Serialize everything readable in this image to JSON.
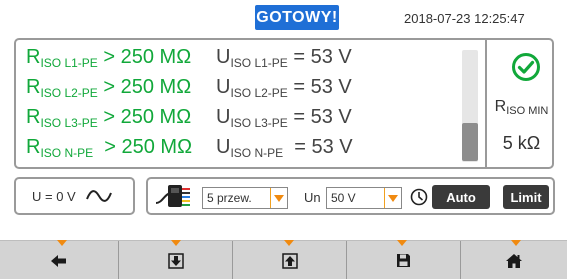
{
  "header": {
    "status": "GOTOWY!",
    "datetime": "2018-07-23 12:25:47"
  },
  "results": [
    {
      "r_main": "R",
      "r_sub": "ISO L1-PE",
      "r_value": " > 250 MΩ",
      "u_main": "U",
      "u_sub": "ISO L1-PE",
      "u_value": " = 53 V"
    },
    {
      "r_main": "R",
      "r_sub": "ISO L2-PE",
      "r_value": " > 250 MΩ",
      "u_main": "U",
      "u_sub": "ISO L2-PE",
      "u_value": " = 53 V"
    },
    {
      "r_main": "R",
      "r_sub": "ISO L3-PE",
      "r_value": " > 250 MΩ",
      "u_main": "U",
      "u_sub": "ISO L3-PE",
      "u_value": " = 53 V"
    },
    {
      "r_main": "R",
      "r_sub": "ISO N-PE",
      "r_value": "  > 250 MΩ",
      "u_main": "U",
      "u_sub": "ISO N-PE",
      "u_value": "  = 53 V"
    }
  ],
  "riso_min": {
    "main": "R",
    "sub": "ISO MIN",
    "value": "5 kΩ"
  },
  "voltage": {
    "text": "U = 0 V"
  },
  "settings": {
    "wires_value": "5 przew.",
    "un_label": "Un",
    "un_value": "50 V",
    "auto_label": "Auto",
    "limit_label": "Limit"
  },
  "scroll_position": 0.66,
  "colors": {
    "status_bg": "#1f6fd6",
    "result_green": "#11a83a",
    "accent_orange": "#f08a10",
    "button_dark": "#3a3a3a",
    "nav_bar": "#d3d3d3"
  },
  "nav_icons": [
    "arrow-left-icon",
    "download-arrow-icon",
    "upload-arrow-icon",
    "save-disk-icon",
    "home-icon"
  ]
}
